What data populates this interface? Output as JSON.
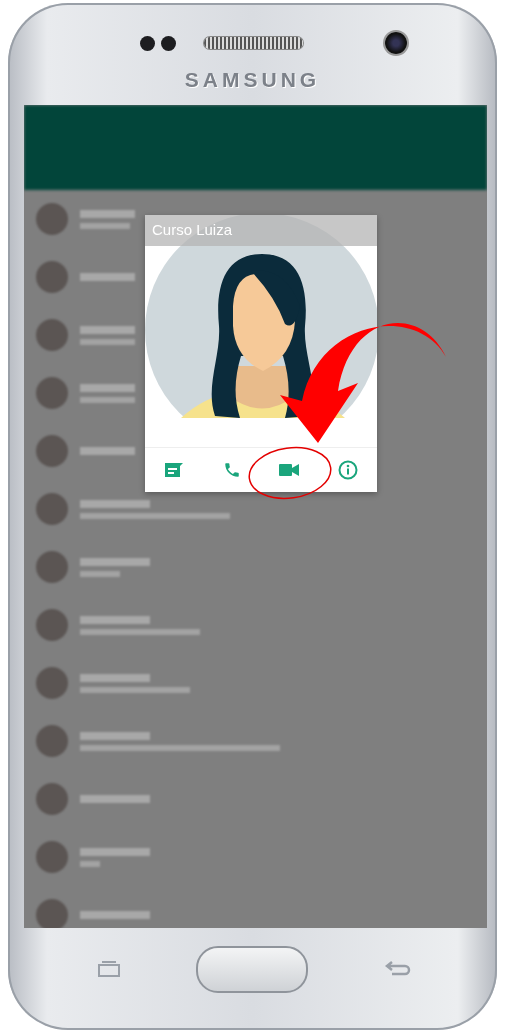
{
  "device": {
    "brand": "SAMSUNG"
  },
  "contact_popup": {
    "title": "Curso Luiza",
    "actions": [
      {
        "kind": "message",
        "highlighted": false
      },
      {
        "kind": "call",
        "highlighted": false
      },
      {
        "kind": "video",
        "highlighted": true
      },
      {
        "kind": "info",
        "highlighted": false
      }
    ]
  }
}
